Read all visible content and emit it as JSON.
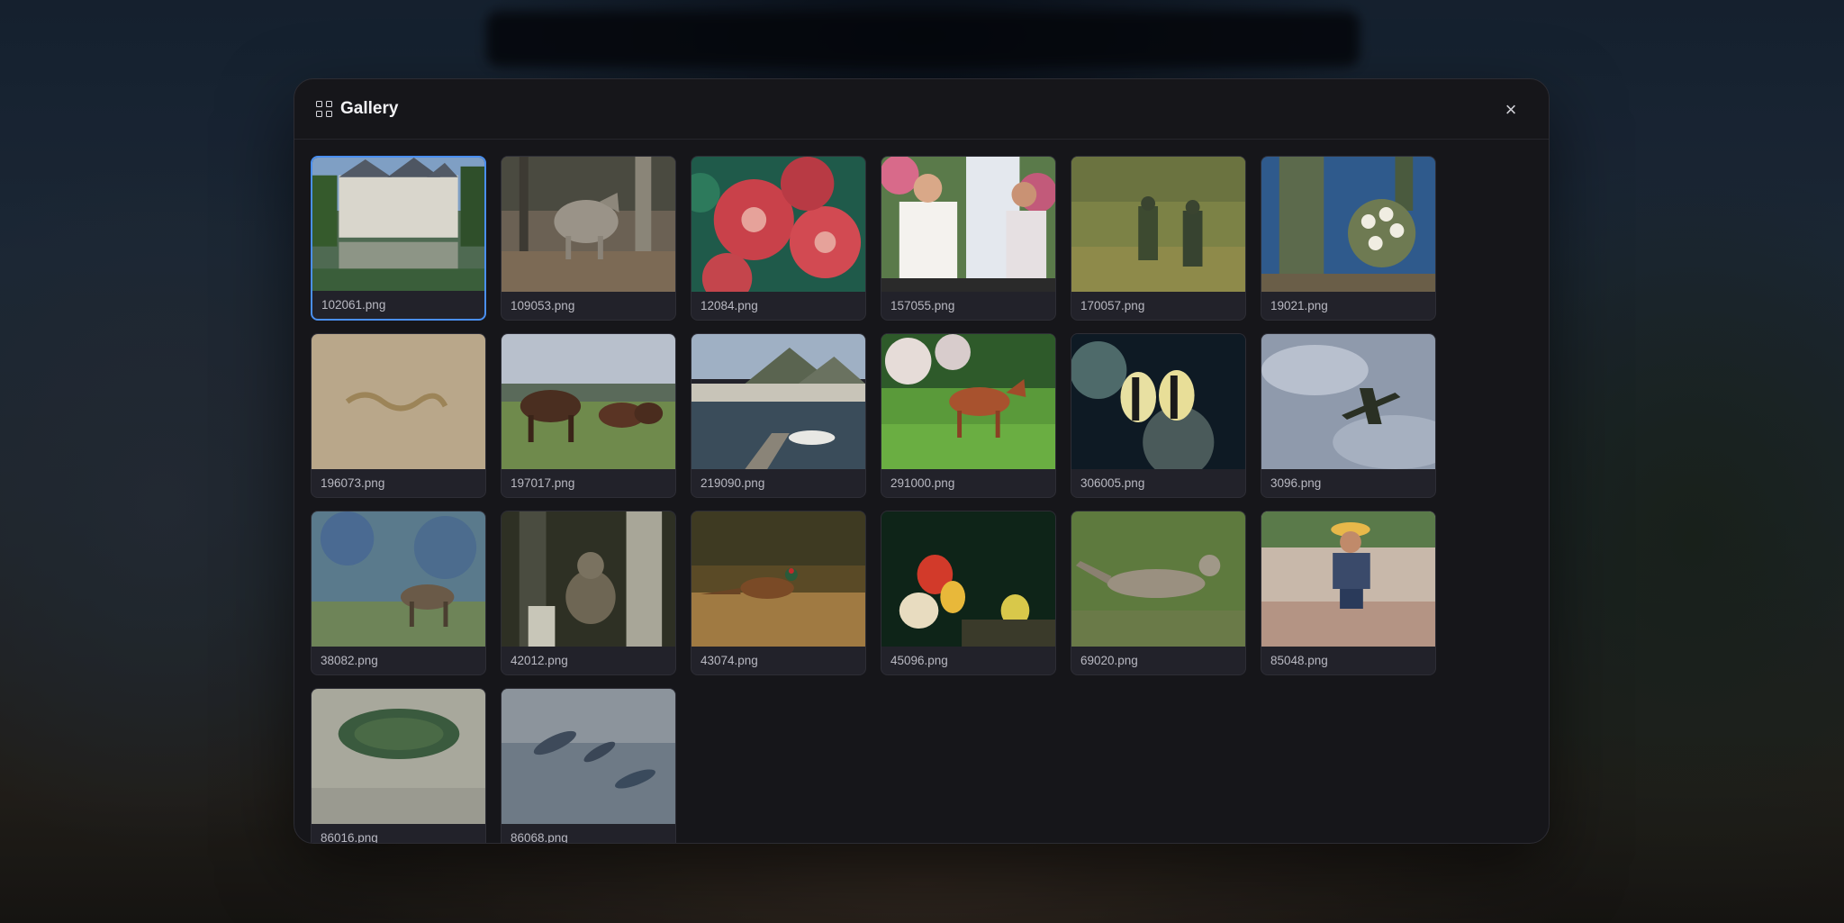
{
  "modal": {
    "title": "Gallery",
    "close_label": "×",
    "grid_icon": "grid-icon",
    "close_icon": "close-icon"
  },
  "selected_index": 0,
  "items": [
    {
      "name": "102061.png",
      "subject": "castle reflected in water"
    },
    {
      "name": "109053.png",
      "subject": "wolf in forest"
    },
    {
      "name": "12084.png",
      "subject": "red coral"
    },
    {
      "name": "157055.png",
      "subject": "couple talking"
    },
    {
      "name": "170057.png",
      "subject": "soldiers on hillside"
    },
    {
      "name": "19021.png",
      "subject": "cactus flowers"
    },
    {
      "name": "196073.png",
      "subject": "snake on sand"
    },
    {
      "name": "197017.png",
      "subject": "horses on field"
    },
    {
      "name": "219090.png",
      "subject": "harbor with boats"
    },
    {
      "name": "291000.png",
      "subject": "horse in meadow"
    },
    {
      "name": "306005.png",
      "subject": "striped fish"
    },
    {
      "name": "3096.png",
      "subject": "airplane in sky"
    },
    {
      "name": "38082.png",
      "subject": "elk in brush"
    },
    {
      "name": "42012.png",
      "subject": "cougar in trees"
    },
    {
      "name": "43074.png",
      "subject": "pheasant in grass"
    },
    {
      "name": "45096.png",
      "subject": "parrots"
    },
    {
      "name": "69020.png",
      "subject": "kangaroo lying"
    },
    {
      "name": "85048.png",
      "subject": "man with straw hat"
    },
    {
      "name": "86016.png",
      "subject": "circular garden"
    },
    {
      "name": "86068.png",
      "subject": "fish in water"
    }
  ]
}
